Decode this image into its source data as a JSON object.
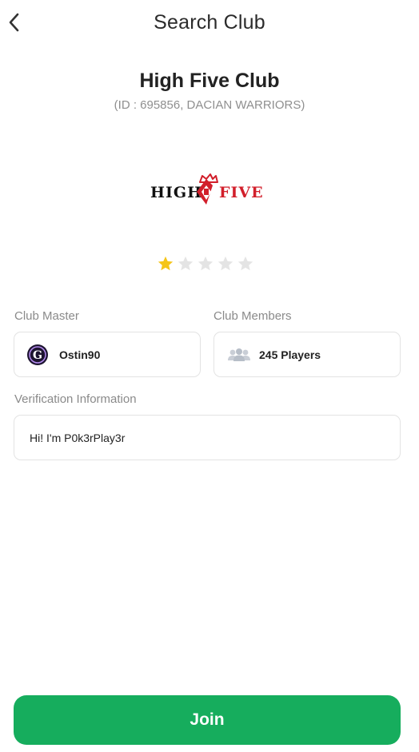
{
  "header": {
    "title": "Search Club"
  },
  "club": {
    "name": "High Five Club",
    "meta": "(ID : 695856, DACIAN WARRIORS)",
    "logo": {
      "left_text": "HIGH",
      "right_text": "FIVE"
    },
    "rating": 1,
    "rating_max": 5
  },
  "club_master": {
    "label": "Club Master",
    "name": "Ostin90"
  },
  "club_members": {
    "label": "Club Members",
    "count_text": "245 Players"
  },
  "verification": {
    "label": "Verification Information",
    "value": "Hi! I'm P0k3rPlay3r"
  },
  "join": {
    "label": "Join"
  },
  "colors": {
    "accent_green": "#16ad5d",
    "star_filled": "#f5c518",
    "star_empty": "#e4e4e4",
    "logo_red": "#d21f2b"
  },
  "icons": [
    "chevron-left-icon",
    "star-icon",
    "users-icon",
    "avatar-g-icon"
  ]
}
